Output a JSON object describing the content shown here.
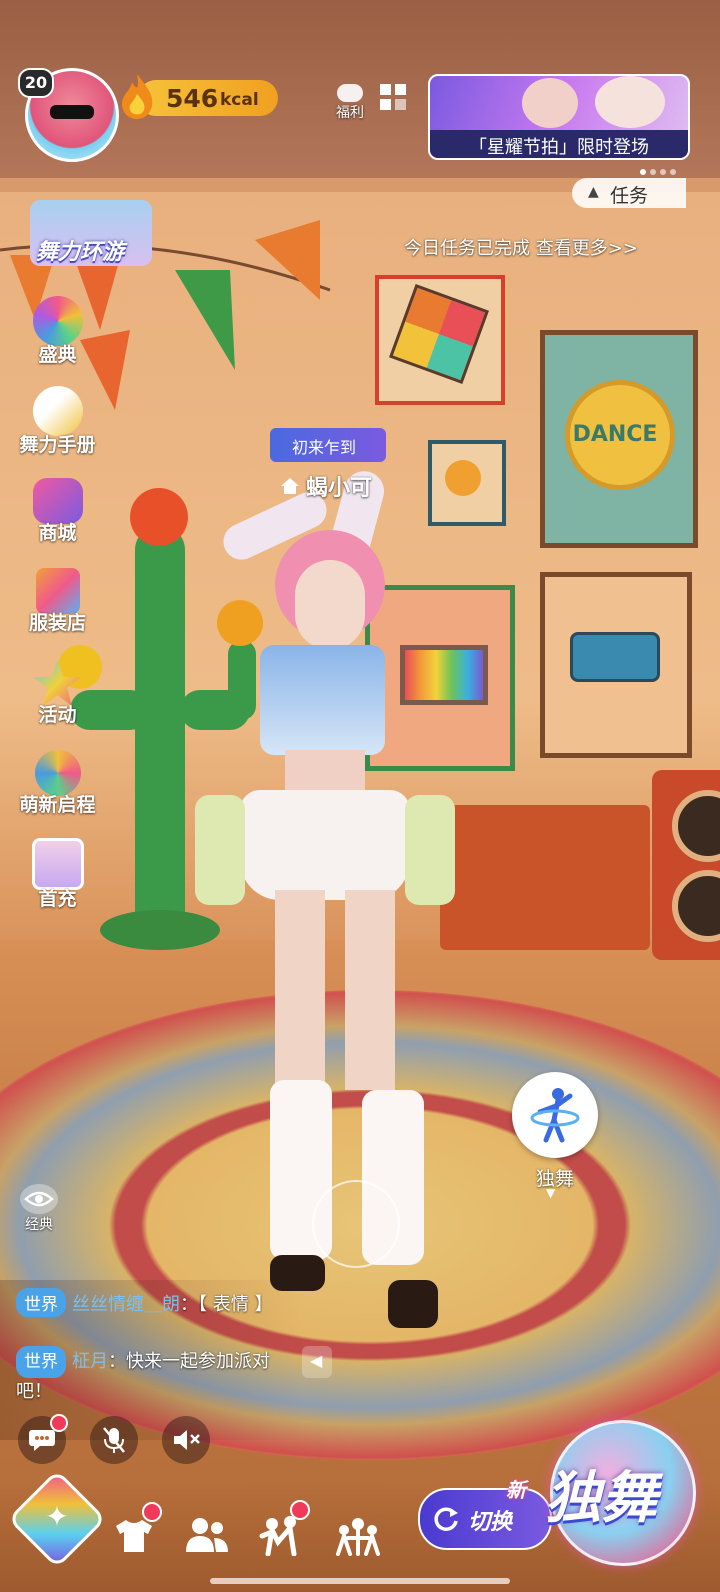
{
  "profile": {
    "level": "20"
  },
  "energy": {
    "value": "546",
    "unit": "kcal"
  },
  "welfare": {
    "label": "福利"
  },
  "banner": {
    "text": "「星耀节拍」限时登场"
  },
  "task": {
    "label": "任务",
    "status": "今日任务已完成 查看更多>>"
  },
  "event_logo": {
    "text": "舞力环游"
  },
  "sidebar": {
    "items": [
      {
        "label": "盛典"
      },
      {
        "label": "舞力手册"
      },
      {
        "label": "商城"
      },
      {
        "label": "服装店"
      },
      {
        "label": "活动"
      },
      {
        "label": "萌新启程"
      },
      {
        "label": "首充"
      }
    ]
  },
  "player": {
    "tag": "初来乍到",
    "name": "蝎小可"
  },
  "wall_poster": {
    "text": "DANCE"
  },
  "solo_button": {
    "label": "独舞"
  },
  "view_toggle": {
    "label": "经典"
  },
  "chat": {
    "messages": [
      {
        "channel": "世界",
        "name": "丝丝情缠＿朗",
        "text": "：【 表情 】"
      },
      {
        "channel": "世界",
        "name": "柾月",
        "text": "：快来一起参加派对吧！"
      }
    ]
  },
  "switch_button": {
    "label": "切换",
    "badge": "新"
  },
  "solo_mode": {
    "label": "独舞"
  },
  "colors": {
    "accent": "#4aa3e8",
    "energy": "#f7c23a",
    "name": "#f0d04a"
  }
}
